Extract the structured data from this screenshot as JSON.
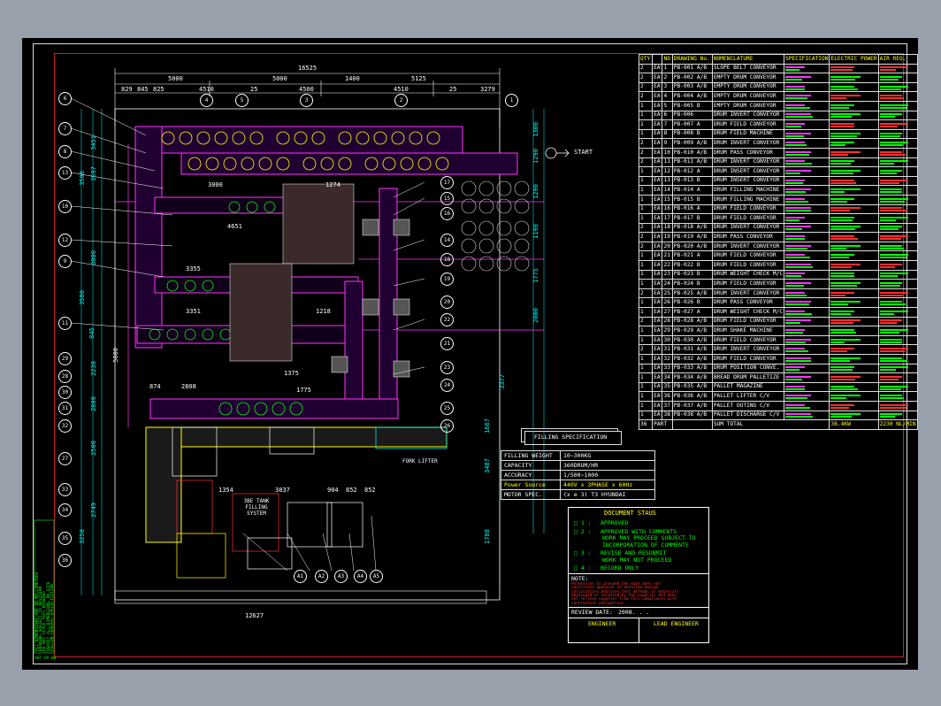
{
  "drawing": {
    "start_label": "START",
    "fork_lifter_label": "FORK LIFTER",
    "tank_label_lines": [
      "3BE TANK",
      "FILLING",
      "SYSTEM"
    ],
    "dimensions_top": [
      "16525",
      "5000",
      "5000",
      "5125",
      "829",
      "845",
      "825",
      "4510",
      "25",
      "4500",
      "1400",
      "4510",
      "25",
      "3279"
    ],
    "dimensions_bottom": "12627",
    "dim_right": [
      "1300",
      "1290",
      "1290",
      "1190",
      "1775",
      "2000",
      "3377",
      "1667",
      "3487",
      "1788"
    ],
    "dim_left": [
      "3451",
      "3500",
      "3000",
      "3597",
      "845",
      "2238",
      "3500",
      "2800",
      "2500",
      "2749",
      "3250"
    ],
    "dim_inner": [
      "3000",
      "1274",
      "4651",
      "3355",
      "3351",
      "2808",
      "1375",
      "1775",
      "1354",
      "3837",
      "904",
      "852",
      "852",
      "874",
      "1218",
      "5000"
    ],
    "balloons_left": [
      "6",
      "7",
      "8",
      "13",
      "10",
      "12",
      "9",
      "11",
      "29",
      "28",
      "30",
      "31",
      "32",
      "27",
      "33",
      "34",
      "35",
      "36"
    ],
    "balloons_top": [
      "4",
      "5",
      "3",
      "2",
      "1"
    ],
    "balloons_right": [
      "17",
      "15",
      "16",
      "14",
      "18",
      "19",
      "20",
      "22",
      "21",
      "23",
      "24",
      "25",
      "26"
    ],
    "balloons_bottom": [
      "A1",
      "A2",
      "A3",
      "A4",
      "A5"
    ],
    "side_note_lines": [
      "ALL DIMENSIONS ARE IN MILLIMETERS",
      "DRAWING SUBJECT TO REVISION",
      "DO NOT SCALE THIS DRAWING",
      "VERIFY ALL DIMENSIONS ON SITE",
      "FOLLOW GENERAL SPECIFICATION"
    ],
    "bottom_left_code": "AAF-OP-00"
  },
  "bom": {
    "headers": [
      "QTY",
      "NO",
      "DRAWING No.",
      "NOMENCLATURE",
      "SPECIFICATION",
      "ELECTRIC POWER",
      "AIR REQ."
    ],
    "rows": [
      {
        "qty": "2",
        "ea": "EA",
        "no": "1",
        "dwg": "PB-001 A/B",
        "name": "SLOPE BELT CONVEYOR"
      },
      {
        "qty": "2",
        "ea": "EA",
        "no": "2",
        "dwg": "PB-002 A/B",
        "name": "EMPTY DRUM CONVEYOR"
      },
      {
        "qty": "2",
        "ea": "EA",
        "no": "3",
        "dwg": "PB-003 A/B",
        "name": "EMPTY DRUM CONVEYOR"
      },
      {
        "qty": "2",
        "ea": "EA",
        "no": "4",
        "dwg": "PB-004 A/B",
        "name": "EMPTY DRUM CONVEYOR"
      },
      {
        "qty": "1",
        "ea": "EA",
        "no": "5",
        "dwg": "PB-005 B",
        "name": "EMPTY DRUM CONVEYOR"
      },
      {
        "qty": "1",
        "ea": "EA",
        "no": "6",
        "dwg": "PB-006",
        "name": "DRUM INVERT CONVEYOR"
      },
      {
        "qty": "1",
        "ea": "EA",
        "no": "7",
        "dwg": "PB-007 A",
        "name": "DRUM FIELD CONVEYOR"
      },
      {
        "qty": "1",
        "ea": "EA",
        "no": "8",
        "dwg": "PB-008 B",
        "name": "DRUM FIELD MACHINE"
      },
      {
        "qty": "2",
        "ea": "EA",
        "no": "9",
        "dwg": "PB-009 A/B",
        "name": "DRUM INVERT CONVEYOR"
      },
      {
        "qty": "2",
        "ea": "EA",
        "no": "10",
        "dwg": "PB-010 A/B",
        "name": "DRUM PASS CONVEYOR"
      },
      {
        "qty": "2",
        "ea": "EA",
        "no": "11",
        "dwg": "PB-011 A/B",
        "name": "DRUM INVERT CONVEYOR"
      },
      {
        "qty": "1",
        "ea": "EA",
        "no": "12",
        "dwg": "PB-012 A",
        "name": "DRUM INSERT CONVEYOR"
      },
      {
        "qty": "1",
        "ea": "EA",
        "no": "13",
        "dwg": "PB-013 B",
        "name": "DRUM INSERT CONVEYOR"
      },
      {
        "qty": "1",
        "ea": "EA",
        "no": "14",
        "dwg": "PB-014 A",
        "name": "DRUM FILLING MACHINE"
      },
      {
        "qty": "1",
        "ea": "EA",
        "no": "15",
        "dwg": "PB-015 B",
        "name": "DRUM FILLING MACHINE"
      },
      {
        "qty": "1",
        "ea": "EA",
        "no": "16",
        "dwg": "PB-016 A",
        "name": "DRUM FIELD CONVEYOR"
      },
      {
        "qty": "1",
        "ea": "EA",
        "no": "17",
        "dwg": "PB-017 B",
        "name": "DRUM FIELD CONVEYOR"
      },
      {
        "qty": "2",
        "ea": "EA",
        "no": "18",
        "dwg": "PB-018 A/B",
        "name": "DRUM INVERT CONVEYOR"
      },
      {
        "qty": "2",
        "ea": "EA",
        "no": "19",
        "dwg": "PB-019 A/B",
        "name": "DRUM PASS CONVEYOR"
      },
      {
        "qty": "2",
        "ea": "EA",
        "no": "20",
        "dwg": "PB-020 A/B",
        "name": "DRUM INVERT CONVEYOR"
      },
      {
        "qty": "1",
        "ea": "EA",
        "no": "21",
        "dwg": "PB-021 A",
        "name": "DRUM FIELD CONVEYOR"
      },
      {
        "qty": "1",
        "ea": "EA",
        "no": "22",
        "dwg": "PB-022 B",
        "name": "DRUM FIELD CONVEYOR"
      },
      {
        "qty": "1",
        "ea": "EA",
        "no": "23",
        "dwg": "PB-023 B",
        "name": "DRUM WEIGHT CHECK M/C"
      },
      {
        "qty": "1",
        "ea": "EA",
        "no": "24",
        "dwg": "PB-024 B",
        "name": "DRUM FIELD CONVEYOR"
      },
      {
        "qty": "2",
        "ea": "EA",
        "no": "25",
        "dwg": "PB-025 A/B",
        "name": "DRUM INVERT CONVEYOR"
      },
      {
        "qty": "1",
        "ea": "EA",
        "no": "26",
        "dwg": "PB-026 B",
        "name": "DRUM PASS CONVEYOR"
      },
      {
        "qty": "1",
        "ea": "EA",
        "no": "27",
        "dwg": "PB-027 A",
        "name": "DRUM WEIGHT CHECK M/C"
      },
      {
        "qty": "2",
        "ea": "EA",
        "no": "28",
        "dwg": "PB-028 A/B",
        "name": "DRUM FIELD CONVEYOR"
      },
      {
        "qty": "1",
        "ea": "EA",
        "no": "29",
        "dwg": "PB-029 A/B",
        "name": "DRUM SHAKE MACHINE"
      },
      {
        "qty": "1",
        "ea": "EA",
        "no": "30",
        "dwg": "PB-030 A/B",
        "name": "DRUM FIELD CONVEYOR"
      },
      {
        "qty": "2",
        "ea": "EA",
        "no": "31",
        "dwg": "PB-031 A/B",
        "name": "DRUM INVERT CONVEYOR"
      },
      {
        "qty": "1",
        "ea": "EA",
        "no": "32",
        "dwg": "PB-032 A/B",
        "name": "DRUM FIELD CONVEYOR"
      },
      {
        "qty": "1",
        "ea": "EA",
        "no": "33",
        "dwg": "PB-033 A/B",
        "name": "DRUM POSITION CONVE."
      },
      {
        "qty": "1",
        "ea": "EA",
        "no": "34",
        "dwg": "PB-034 A/B",
        "name": "BREAD DRUM PALLETIZE"
      },
      {
        "qty": "1",
        "ea": "EA",
        "no": "35",
        "dwg": "PB-035 A/B",
        "name": "PALLET MAGAZINE"
      },
      {
        "qty": "1",
        "ea": "EA",
        "no": "36",
        "dwg": "PB-036 A/B",
        "name": "PALLET LIFTER C/V"
      },
      {
        "qty": "1",
        "ea": "EA",
        "no": "37",
        "dwg": "PB-037 A/B",
        "name": "PALLET OUTING C/V"
      },
      {
        "qty": "1",
        "ea": "EA",
        "no": "38",
        "dwg": "PB-038 A/B",
        "name": "PALLET DISCHARGE C/V"
      }
    ],
    "total": {
      "qty": "36",
      "unit": "PART",
      "label": "SUM TOTAL",
      "power": "36.4KW",
      "air": "2230 NL/MIN"
    }
  },
  "filling_spec": {
    "title": "FILLING SPECIFICATION",
    "rows": [
      [
        "FILLING WEIGHT",
        "10~300KG"
      ],
      [
        "CAPACITY",
        "360DRUM/HR"
      ],
      [
        "ACCURACY",
        "1/500~1000"
      ],
      [
        "Power Source",
        "440V x 3PHASE x 60Hz"
      ],
      [
        "MOTOR SPEC.",
        "(x e 3) T3 HYUNDAI"
      ]
    ]
  },
  "doc_status": {
    "title": "DOCUMENT STAUS",
    "items": [
      {
        "box": "□ 1 :",
        "text": [
          "APPROVED"
        ]
      },
      {
        "box": "□ 2 :",
        "text": [
          "APPROVED WITH COMMENTS",
          "WORK MAY PROCEED SUBJECT TO",
          "INCORPORATION OF COMMENTS"
        ]
      },
      {
        "box": "□ 3 :",
        "text": [
          "REVISE AND RESUBMIT",
          "WORK MAY NOT PROCEED"
        ]
      },
      {
        "box": "□ 4 :",
        "text": [
          "RECORD ONLY"
        ]
      }
    ],
    "note_label": "NOTE:",
    "note_lines": [
      "Permission to proceed the work does not",
      "constitute approval of detailed design,",
      "calculations,analyses,test methods or materials",
      "developed or selected by the supplier and does",
      "not relieve supplier from full compliance with",
      "contractual obligations."
    ],
    "review_date_label": "REVIEW DATE:",
    "review_date_value": "2008.  .  .",
    "engineer_label": "ENGINEER",
    "lead_engineer_label": "LEAD ENGINEER"
  }
}
